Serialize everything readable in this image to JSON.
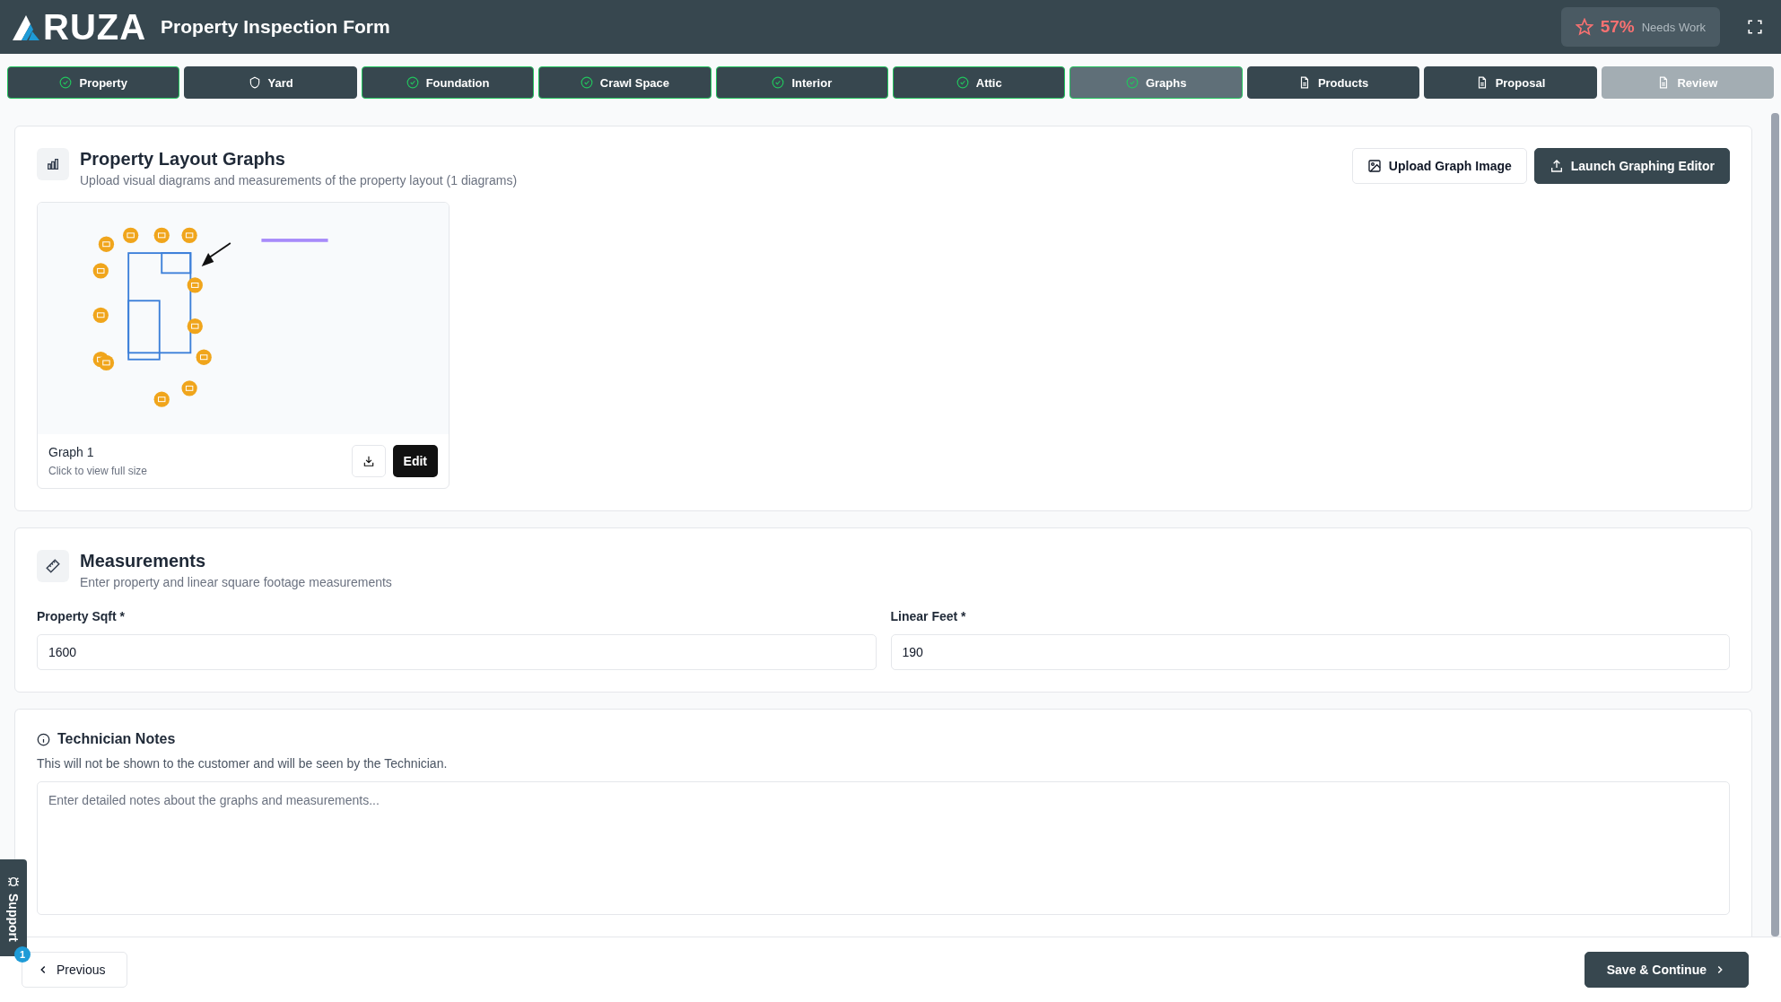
{
  "header": {
    "logo": "RUZA",
    "title": "Property Inspection Form",
    "score": {
      "value": "57%",
      "label": "Needs Work"
    }
  },
  "tabs": [
    {
      "label": "Property",
      "kind": "complete",
      "selected": false
    },
    {
      "label": "Yard",
      "kind": "pending",
      "selected": false
    },
    {
      "label": "Foundation",
      "kind": "complete",
      "selected": false
    },
    {
      "label": "Crawl Space",
      "kind": "complete",
      "selected": false
    },
    {
      "label": "Interior",
      "kind": "complete",
      "selected": false
    },
    {
      "label": "Attic",
      "kind": "complete",
      "selected": false
    },
    {
      "label": "Graphs",
      "kind": "complete",
      "selected": true
    },
    {
      "label": "Products",
      "kind": "document",
      "selected": false
    },
    {
      "label": "Proposal",
      "kind": "document",
      "selected": false
    },
    {
      "label": "Review",
      "kind": "document",
      "selected": false,
      "disabled": true
    }
  ],
  "graphs_section": {
    "title": "Property Layout Graphs",
    "subtitle": "Upload visual diagrams and measurements of the property layout (1 diagrams)",
    "buttons": [
      "Upload Graph Image",
      "Launch Graphing Editor"
    ],
    "graphs": [
      {
        "title": "Graph 1",
        "hint": "Click to view full size",
        "edit": "Edit"
      }
    ]
  },
  "measurements": {
    "title": "Measurements",
    "subtitle": "Enter property and linear square footage measurements",
    "fields": [
      {
        "label": "Property Sqft *",
        "value": "1600"
      },
      {
        "label": "Linear Feet *",
        "value": "190"
      }
    ]
  },
  "notes": {
    "title": "Technician Notes",
    "subtitle": "This will not be shown to the customer and will be seen by the Technician.",
    "placeholder": "Enter detailed notes about the graphs and measurements..."
  },
  "support": {
    "label": "Support",
    "badge": "1"
  },
  "footer": {
    "previous": "Previous",
    "next": "Save & Continue"
  }
}
